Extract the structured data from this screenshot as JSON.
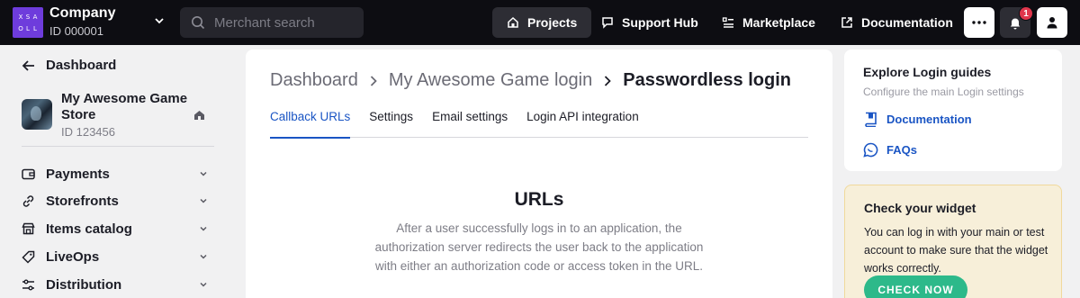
{
  "company": {
    "logo_letters": [
      "X",
      "S",
      "A",
      "O",
      "L",
      "L"
    ],
    "name": "Company",
    "id": "ID 000001"
  },
  "search": {
    "placeholder": "Merchant search"
  },
  "nav": [
    {
      "label": "Projects",
      "icon": "home-icon",
      "active": true
    },
    {
      "label": "Support Hub",
      "icon": "chat-icon",
      "active": false
    },
    {
      "label": "Marketplace",
      "icon": "list-icon",
      "active": false
    },
    {
      "label": "Documentation",
      "icon": "external-link-icon",
      "active": false
    }
  ],
  "notifications": {
    "count": "1"
  },
  "sidebar": {
    "back_label": "Dashboard",
    "project": {
      "name": "My Awesome Game Store",
      "id": "ID 123456"
    },
    "items": [
      {
        "label": "Payments",
        "icon": "wallet-icon"
      },
      {
        "label": "Storefronts",
        "icon": "link-icon"
      },
      {
        "label": "Items catalog",
        "icon": "store-icon"
      },
      {
        "label": "LiveOps",
        "icon": "tag-icon"
      },
      {
        "label": "Distribution",
        "icon": "sliders-icon"
      }
    ]
  },
  "breadcrumb": {
    "items": [
      "Dashboard",
      "My Awesome Game login"
    ],
    "current": "Passwordless login"
  },
  "tabs": [
    "Callback URLs",
    "Settings",
    "Email settings",
    "Login API integration"
  ],
  "active_tab": "Callback URLs",
  "urls": {
    "title": "URLs",
    "description": "After a user successfully logs in to an application, the authorization server redirects the user back to the application with either an authorization code or access token in the URL."
  },
  "guides": {
    "title": "Explore Login guides",
    "subtitle": "Configure the main Login settings",
    "links": [
      {
        "label": "Documentation",
        "icon": "book-icon"
      },
      {
        "label": "FAQs",
        "icon": "chat-icon"
      }
    ]
  },
  "widget": {
    "title": "Check your widget",
    "description": "You can log in with your main or test account to make sure that the widget works correctly.",
    "button_label": "CHECK NOW"
  },
  "colors": {
    "accent": "#1a55c4",
    "topbar": "#0d0d12",
    "logo": "#6e3cdc",
    "check_button": "#2db98a",
    "badge": "#e0364c"
  }
}
